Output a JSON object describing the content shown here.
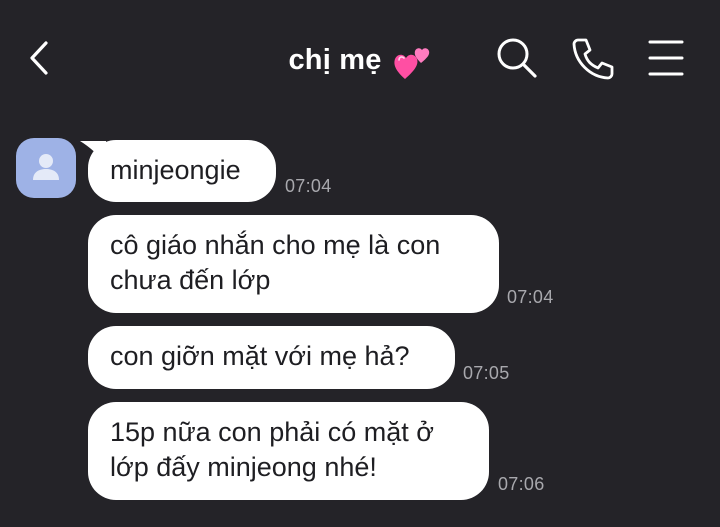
{
  "header": {
    "title": "chị mẹ",
    "title_emoji": "two-hearts-icon",
    "icons": [
      "back-arrow-icon",
      "search-icon",
      "phone-icon",
      "menu-icon"
    ]
  },
  "conversation": {
    "contact_avatar": "user-silhouette-icon",
    "messages": [
      {
        "text": "minjeongie",
        "time": "07:04"
      },
      {
        "text": "cô giáo nhắn cho mẹ là con\nchưa đến lớp",
        "time": "07:04"
      },
      {
        "text": "con giỡn mặt với mẹ hả?",
        "time": "07:05"
      },
      {
        "text": "15p nữa con phải có mặt ở\nlớp đấy minjeong nhé!",
        "time": "07:06"
      }
    ]
  },
  "colors": {
    "background": "#242328",
    "bubble": "#ffffff",
    "bubble_text": "#1e1e22",
    "timestamp": "#a8a8ad",
    "avatar": "#9eb2e6",
    "hearts": "#ff4fa3"
  }
}
